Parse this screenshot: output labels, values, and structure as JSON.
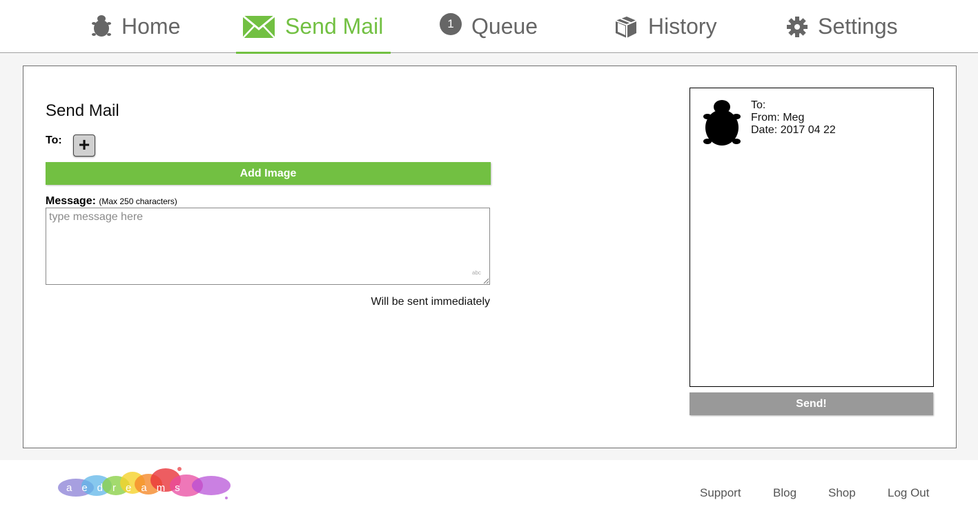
{
  "nav": {
    "tabs": [
      {
        "label": "Home",
        "icon": "turtle-icon",
        "active": false
      },
      {
        "label": "Send Mail",
        "icon": "envelope-icon",
        "active": true
      },
      {
        "label": "Queue",
        "icon": "queue-count-badge",
        "badge": "1",
        "active": false
      },
      {
        "label": "History",
        "icon": "box-icon",
        "active": false
      },
      {
        "label": "Settings",
        "icon": "gear-icon",
        "active": false
      }
    ]
  },
  "compose": {
    "title": "Send Mail",
    "to_label": "To:",
    "add_recipient": "+",
    "add_image_label": "Add Image",
    "message_label": "Message:",
    "message_hint": "(Max 250 characters)",
    "message_value": "",
    "message_placeholder": "type message here",
    "send_note": "Will be sent immediately"
  },
  "preview": {
    "to": "To:",
    "from": "From: Meg",
    "date": "Date: 2017 04 22",
    "send_label": "Send!"
  },
  "footer": {
    "logo_text": "aedreams",
    "links": [
      "Support",
      "Blog",
      "Shop",
      "Log Out"
    ]
  },
  "colors": {
    "accent": "#72c042",
    "nav_text": "#666666",
    "send_button": "#999999",
    "background": "#f5f5f5"
  }
}
